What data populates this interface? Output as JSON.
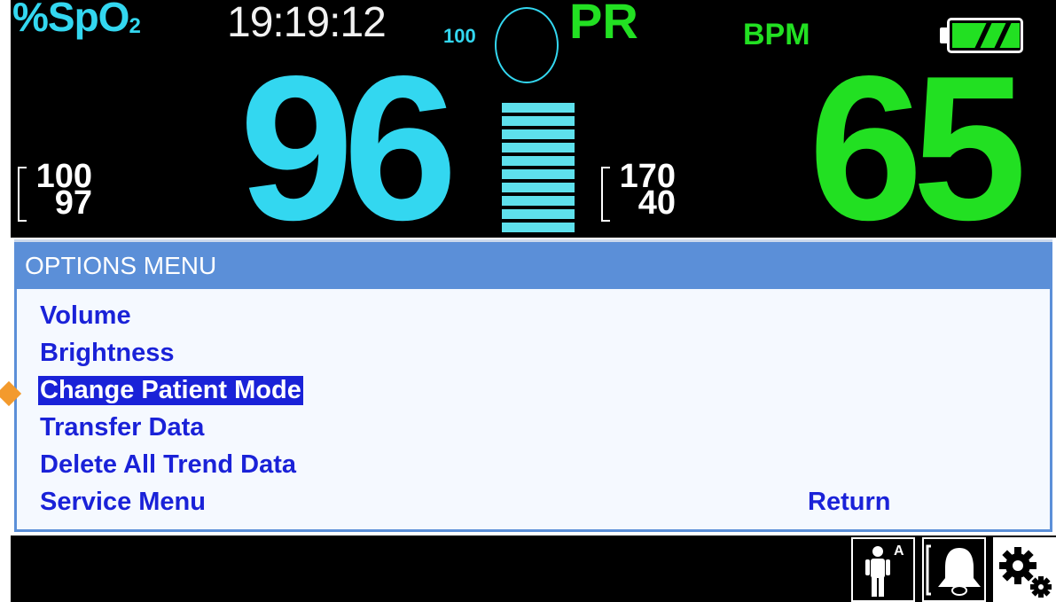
{
  "vitals": {
    "spo2_label": "%SpO",
    "spo2_sub": "2",
    "time": "19:19:12",
    "pleth_scale": "100",
    "pr_label": "PR",
    "bpm_label": "BPM",
    "spo2_value": "96",
    "pr_value": "65",
    "spo2_limit_high": "100",
    "spo2_limit_low": "97",
    "pr_limit_high": "170",
    "pr_limit_low": "40",
    "pulse_bar_segments": 10
  },
  "battery": {
    "icon": "battery-icon",
    "level": "full",
    "color": "#22e022"
  },
  "menu": {
    "title": "OPTIONS MENU",
    "items": [
      {
        "label": "Volume",
        "selected": false
      },
      {
        "label": "Brightness",
        "selected": false
      },
      {
        "label": "Change Patient Mode",
        "selected": true
      },
      {
        "label": "Transfer Data",
        "selected": false
      },
      {
        "label": "Delete All Trend Data",
        "selected": false
      },
      {
        "label": "Service Menu",
        "selected": false
      }
    ],
    "return_label": "Return"
  },
  "status_icons": {
    "patient_mode_icon": "adult-patient-icon",
    "patient_mode_badge": "A",
    "alarm_icon": "alarm-bell-icon",
    "settings_icon": "gears-icon"
  },
  "colors": {
    "spo2": "#33d7f0",
    "pr": "#22e022",
    "menu_header": "#5b8fd8",
    "menu_text": "#1a22d8",
    "pointer": "#f39a2d"
  }
}
